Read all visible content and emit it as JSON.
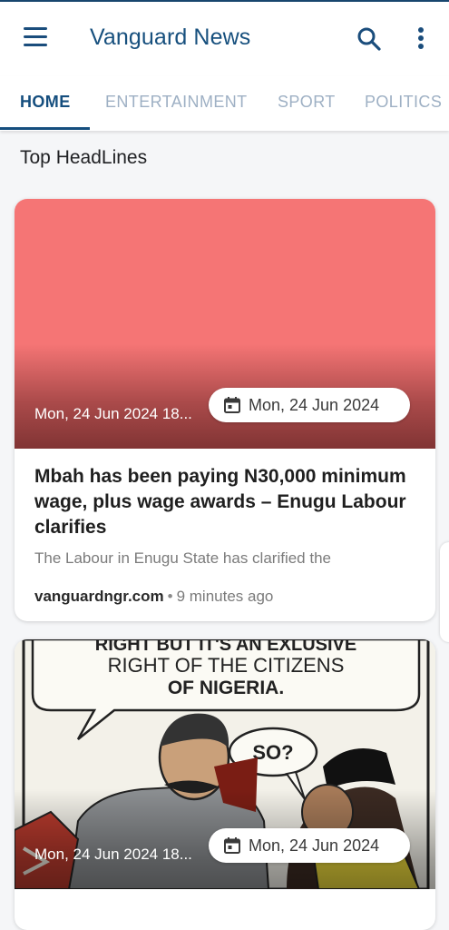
{
  "app": {
    "title": "Vanguard News"
  },
  "tabs": [
    {
      "label": "HOME",
      "active": true
    },
    {
      "label": "ENTERTAINMENT",
      "active": false
    },
    {
      "label": "SPORT",
      "active": false
    },
    {
      "label": "POLITICS",
      "active": false
    }
  ],
  "section": {
    "title": "Top HeadLines"
  },
  "articles": [
    {
      "image_timestamp": "Mon, 24 Jun 2024 18...",
      "date_chip": "Mon, 24 Jun 2024",
      "headline": "Mbah has been paying N30,000 minimum wage, plus wage awards – Enugu Labour clarifies",
      "snippet": "The Labour in Enugu State has  clarified the",
      "source": "vanguardngr.com",
      "time_ago": "9 minutes ago",
      "image_color": "#f57575"
    },
    {
      "image_timestamp": "Mon, 24 Jun 2024 18...",
      "date_chip": "Mon, 24 Jun 2024",
      "cartoon_text": [
        "RIGHT BUT IT'S AN EXLUSIVE",
        "RIGHT OF THE CITIZENS",
        "OF NIGERIA.",
        "SO?"
      ]
    }
  ],
  "colors": {
    "brand": "#17507e",
    "tab_inactive": "#9eb0c4",
    "background": "#f5f6f8"
  },
  "icons": [
    "hamburger-menu-icon",
    "search-icon",
    "more-vertical-icon",
    "calendar-icon"
  ]
}
